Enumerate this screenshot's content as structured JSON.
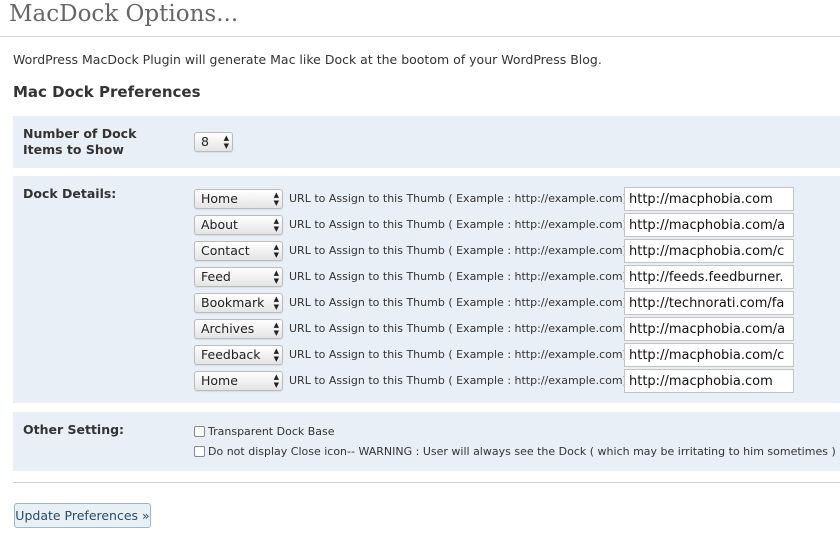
{
  "page": {
    "title": "MacDock Options...",
    "intro": "WordPress MacDock Plugin will generate Mac like Dock at the bootom of your WordPress Blog.",
    "prefs_heading": "Mac Dock Preferences"
  },
  "dock_count": {
    "label": "Number of Dock Items to Show",
    "value": "8"
  },
  "dock_details": {
    "label": "Dock Details:",
    "url_hint": "URL to Assign to this Thumb ( Example : http://example.com)",
    "rows": [
      {
        "thumb": "Home",
        "url": "http://macphobia.com"
      },
      {
        "thumb": "About",
        "url": "http://macphobia.com/a"
      },
      {
        "thumb": "Contact",
        "url": "http://macphobia.com/c"
      },
      {
        "thumb": "Feed",
        "url": "http://feeds.feedburner."
      },
      {
        "thumb": "Bookmark",
        "url": "http://technorati.com/fa"
      },
      {
        "thumb": "Archives",
        "url": "http://macphobia.com/a"
      },
      {
        "thumb": "Feedback",
        "url": "http://macphobia.com/c"
      },
      {
        "thumb": "Home",
        "url": "http://macphobia.com"
      }
    ]
  },
  "other_setting": {
    "label": "Other Setting:",
    "options": [
      {
        "label": "Transparent Dock Base",
        "checked": false
      },
      {
        "label": "Do not display Close icon-- WARNING : User will always see the Dock ( which may be irritating to him sometimes )",
        "checked": false
      }
    ]
  },
  "update_button": "Update Preferences »"
}
